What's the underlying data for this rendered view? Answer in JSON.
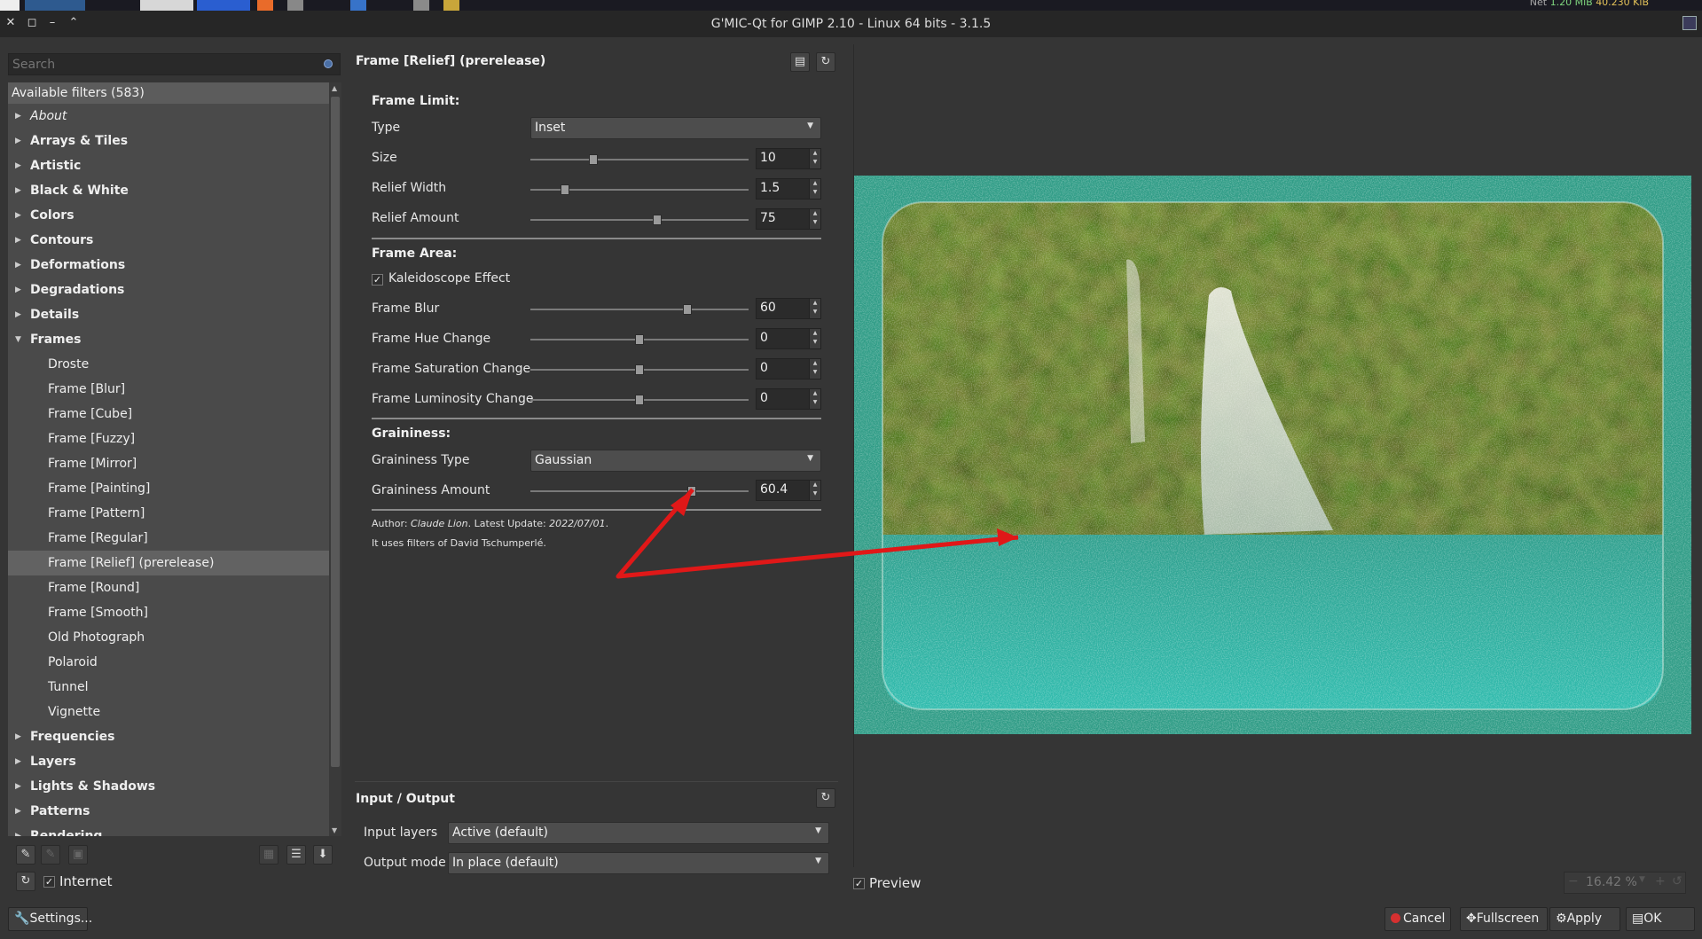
{
  "window": {
    "title": "G'MIC-Qt for GIMP 2.10 - Linux 64 bits - 3.1.5"
  },
  "system_bar": {
    "net_label": "Net",
    "net_down": "1.20 MiB",
    "net_up": "40.230 KiB"
  },
  "search": {
    "placeholder": "Search"
  },
  "filters": {
    "header": "Available filters (583)",
    "rows": [
      {
        "label": "About",
        "kind": "about"
      },
      {
        "label": "Arrays & Tiles",
        "kind": "cat"
      },
      {
        "label": "Artistic",
        "kind": "cat"
      },
      {
        "label": "Black & White",
        "kind": "cat"
      },
      {
        "label": "Colors",
        "kind": "cat"
      },
      {
        "label": "Contours",
        "kind": "cat"
      },
      {
        "label": "Deformations",
        "kind": "cat"
      },
      {
        "label": "Degradations",
        "kind": "cat"
      },
      {
        "label": "Details",
        "kind": "cat"
      },
      {
        "label": "Frames",
        "kind": "cat-open"
      },
      {
        "label": "Droste",
        "kind": "sub"
      },
      {
        "label": "Frame [Blur]",
        "kind": "sub"
      },
      {
        "label": "Frame [Cube]",
        "kind": "sub"
      },
      {
        "label": "Frame [Fuzzy]",
        "kind": "sub"
      },
      {
        "label": "Frame [Mirror]",
        "kind": "sub"
      },
      {
        "label": "Frame [Painting]",
        "kind": "sub"
      },
      {
        "label": "Frame [Pattern]",
        "kind": "sub"
      },
      {
        "label": "Frame [Regular]",
        "kind": "sub"
      },
      {
        "label": "Frame [Relief] (prerelease)",
        "kind": "sub-selected"
      },
      {
        "label": "Frame [Round]",
        "kind": "sub"
      },
      {
        "label": "Frame [Smooth]",
        "kind": "sub"
      },
      {
        "label": "Old Photograph",
        "kind": "sub"
      },
      {
        "label": "Polaroid",
        "kind": "sub"
      },
      {
        "label": "Tunnel",
        "kind": "sub"
      },
      {
        "label": "Vignette",
        "kind": "sub"
      },
      {
        "label": "Frequencies",
        "kind": "cat"
      },
      {
        "label": "Layers",
        "kind": "cat"
      },
      {
        "label": "Lights & Shadows",
        "kind": "cat"
      },
      {
        "label": "Patterns",
        "kind": "cat"
      },
      {
        "label": "Rendering",
        "kind": "cat"
      }
    ]
  },
  "sources": {
    "internet_label": "Internet",
    "internet_checked": true
  },
  "settings_button": "Settings...",
  "filter": {
    "title": "Frame [Relief] (prerelease)",
    "frame_limit": {
      "heading": "Frame Limit:",
      "type_label": "Type",
      "type_value": "Inset",
      "size_label": "Size",
      "size_value": "10",
      "relief_width_label": "Relief Width",
      "relief_width_value": "1.5",
      "relief_amount_label": "Relief Amount",
      "relief_amount_value": "75"
    },
    "frame_area": {
      "heading": "Frame Area:",
      "kaleidoscope_label": "Kaleidoscope Effect",
      "kaleidoscope_checked": true,
      "blur_label": "Frame Blur",
      "blur_value": "60",
      "hue_label": "Frame Hue Change",
      "hue_value": "0",
      "saturation_label": "Frame Saturation Change",
      "saturation_value": "0",
      "luminosity_label": "Frame Luminosity Change",
      "luminosity_value": "0"
    },
    "graininess": {
      "heading": "Graininess:",
      "type_label": "Graininess Type",
      "type_value": "Gaussian",
      "amount_label": "Graininess Amount",
      "amount_value": "60.4"
    },
    "author_prefix": "Author: ",
    "author": "Claude Lion",
    "update_prefix": ". Latest Update: ",
    "update": "2022/07/01",
    "update_suffix": ".",
    "credits": "It uses filters of David Tschumperlé."
  },
  "slider_levels": {
    "size": 0.29,
    "relief_width": 0.16,
    "relief_amount": 0.58,
    "blur": 0.72,
    "hue": 0.5,
    "saturation": 0.5,
    "luminosity": 0.5,
    "grain": 0.74
  },
  "io": {
    "title": "Input / Output",
    "input_label": "Input layers",
    "input_value": "Active (default)",
    "output_label": "Output mode",
    "output_value": "In place (default)"
  },
  "preview": {
    "label": "Preview",
    "checked": true,
    "zoom": "16.42 %"
  },
  "buttons": {
    "cancel": "Cancel",
    "fullscreen": "Fullscreen",
    "apply": "Apply",
    "ok": "OK"
  },
  "colors": {
    "accent_arrow": "#e01818",
    "panel_bg": "#353535",
    "tree_bg": "#4a4a4a"
  }
}
